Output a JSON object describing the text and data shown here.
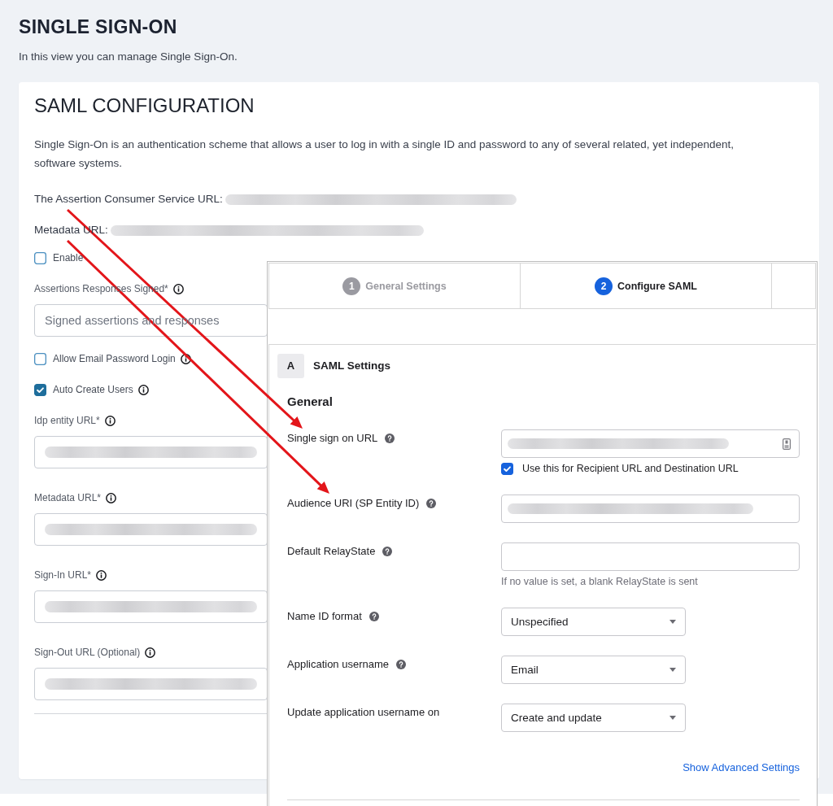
{
  "header": {
    "title": "SINGLE SIGN-ON",
    "subtitle": "In this view you can manage Single Sign-On."
  },
  "card": {
    "title": "SAML CONFIGURATION",
    "description": "Single Sign-On is an authentication scheme that allows a user to log in with a single ID and password to any of several related, yet independent, software systems.",
    "url_lines": [
      {
        "label": "The Assertion Consumer Service URL:",
        "blurred": true
      },
      {
        "label": "Metadata URL:",
        "blurred": true
      }
    ],
    "fields": [
      {
        "kind": "checkbox",
        "label": "Enable",
        "checked": false,
        "info": false
      },
      {
        "kind": "field",
        "label": "Assertions Responses Signed*",
        "info": true,
        "placeholder": "Signed assertions and responses"
      },
      {
        "kind": "checkbox",
        "label": "Allow Email Password Login",
        "checked": false,
        "info": true
      },
      {
        "kind": "checkbox",
        "label": "Auto Create Users",
        "checked": true,
        "info": true
      },
      {
        "kind": "field",
        "label": "Idp entity URL*",
        "info": true,
        "blurred": true
      },
      {
        "kind": "field",
        "label": "Metadata URL*",
        "info": true,
        "blurred": true
      },
      {
        "kind": "field",
        "label": "Sign-In URL*",
        "info": true,
        "blurred": true
      },
      {
        "kind": "field",
        "label": "Sign-Out URL (Optional)",
        "info": true,
        "blurred": true
      }
    ]
  },
  "inset": {
    "steps": [
      {
        "number": "1",
        "label": "General Settings",
        "selected": false
      },
      {
        "number": "2",
        "label": "Configure SAML",
        "selected": true
      }
    ],
    "section": {
      "badge": "A",
      "title": "SAML Settings",
      "group_title": "General",
      "rows": [
        {
          "kind": "input",
          "label": "Single sign on URL",
          "help": true,
          "blurred": true,
          "autofill_icon": true,
          "checkbox": {
            "label": "Use this for Recipient URL and Destination URL",
            "checked": true
          }
        },
        {
          "kind": "input",
          "label": "Audience URI (SP Entity ID)",
          "help": true,
          "blurred": true
        },
        {
          "kind": "input",
          "label": "Default RelayState",
          "help": true,
          "hint": "If no value is set, a blank RelayState is sent"
        },
        {
          "kind": "select",
          "label": "Name ID format",
          "help": true,
          "value": "Unspecified"
        },
        {
          "kind": "select",
          "label": "Application username",
          "help": true,
          "value": "Email"
        },
        {
          "kind": "select",
          "label": "Update application username on",
          "help": false,
          "value": "Create and update"
        }
      ],
      "link": "Show Advanced Settings"
    }
  },
  "annotations": [
    {
      "kind": "arrow"
    },
    {
      "kind": "arrow"
    }
  ]
}
